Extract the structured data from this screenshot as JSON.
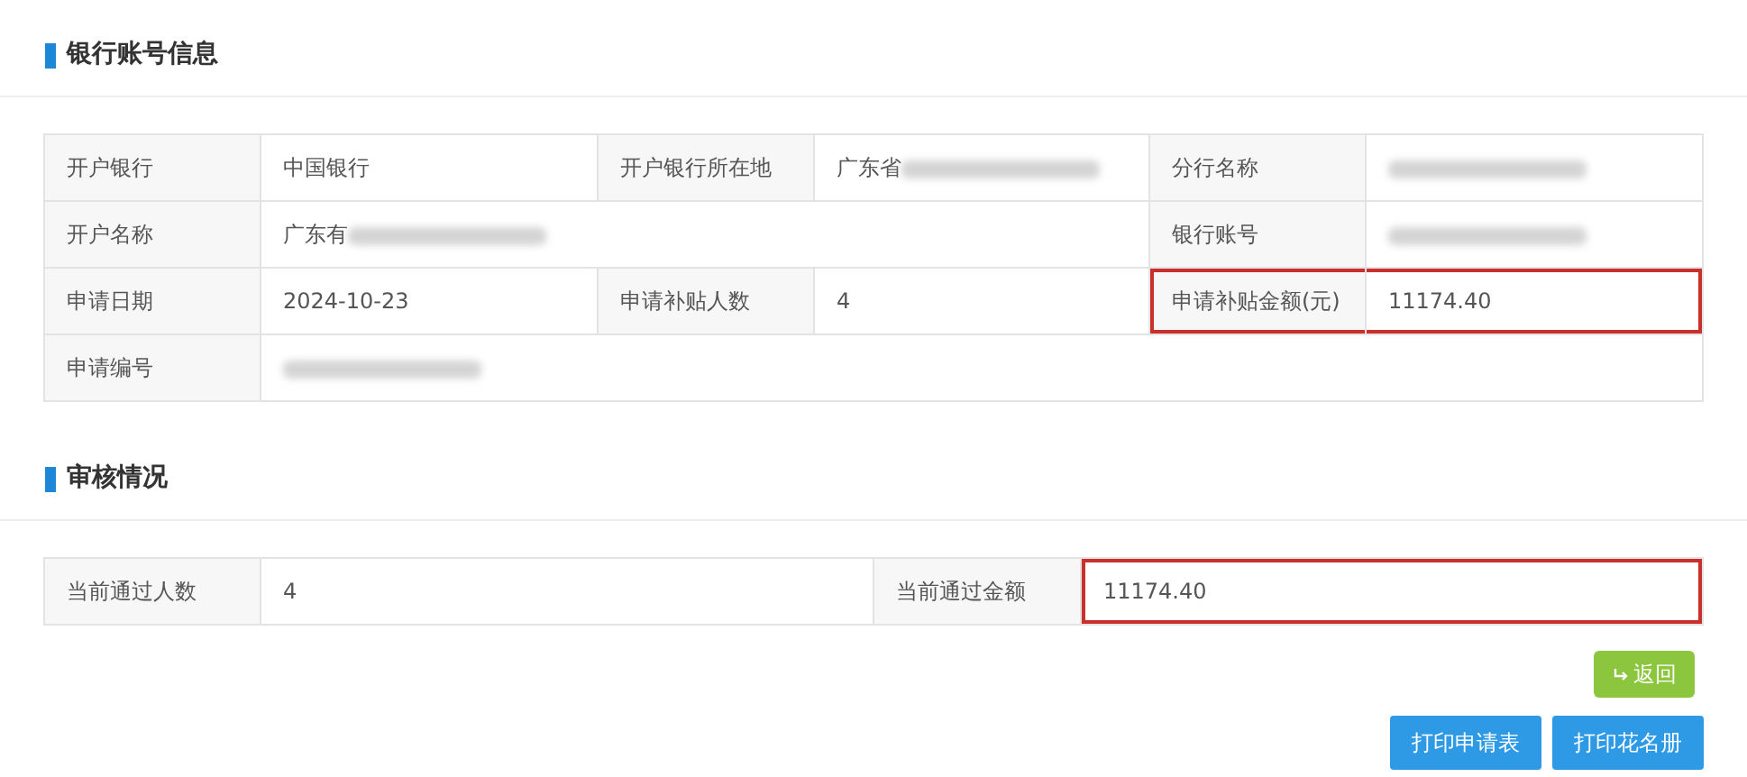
{
  "sections": [
    {
      "title": "银行账号信息",
      "table": {
        "rows": [
          [
            {
              "kind": "label",
              "text": "开户银行"
            },
            {
              "kind": "value",
              "text": "中国银行"
            },
            {
              "kind": "label",
              "text": "开户银行所在地"
            },
            {
              "kind": "value",
              "text": "广东省",
              "blurred": true
            },
            {
              "kind": "label",
              "text": "分行名称"
            },
            {
              "kind": "value",
              "blurred": true
            }
          ],
          [
            {
              "kind": "label",
              "text": "开户名称"
            },
            {
              "kind": "value",
              "text": "广东有",
              "blurred": true,
              "colspan": 3
            },
            {
              "kind": "label",
              "text": "银行账号"
            },
            {
              "kind": "value",
              "blurred": true
            }
          ],
          [
            {
              "kind": "label",
              "text": "申请日期"
            },
            {
              "kind": "value",
              "text": "2024-10-23"
            },
            {
              "kind": "label",
              "text": "申请补贴人数"
            },
            {
              "kind": "value",
              "text": "4"
            },
            {
              "kind": "label",
              "text": "申请补贴金额(元)",
              "highlighted": true
            },
            {
              "kind": "value",
              "text": "11174.40",
              "highlighted": true
            }
          ],
          [
            {
              "kind": "label",
              "text": "申请编号"
            },
            {
              "kind": "value",
              "blurred": true,
              "colspan": 5
            }
          ]
        ]
      }
    },
    {
      "title": "审核情况",
      "table": {
        "rows": [
          [
            {
              "kind": "label",
              "text": "当前通过人数"
            },
            {
              "kind": "value",
              "text": "4"
            },
            {
              "kind": "label",
              "text": "当前通过金额"
            },
            {
              "kind": "value",
              "text": "11174.40",
              "highlighted": true
            }
          ]
        ]
      }
    }
  ],
  "buttons": [
    {
      "kind": "back",
      "label": "返回"
    },
    {
      "kind": "print",
      "label": "打印申请表"
    },
    {
      "kind": "print",
      "label": "打印花名册"
    }
  ]
}
